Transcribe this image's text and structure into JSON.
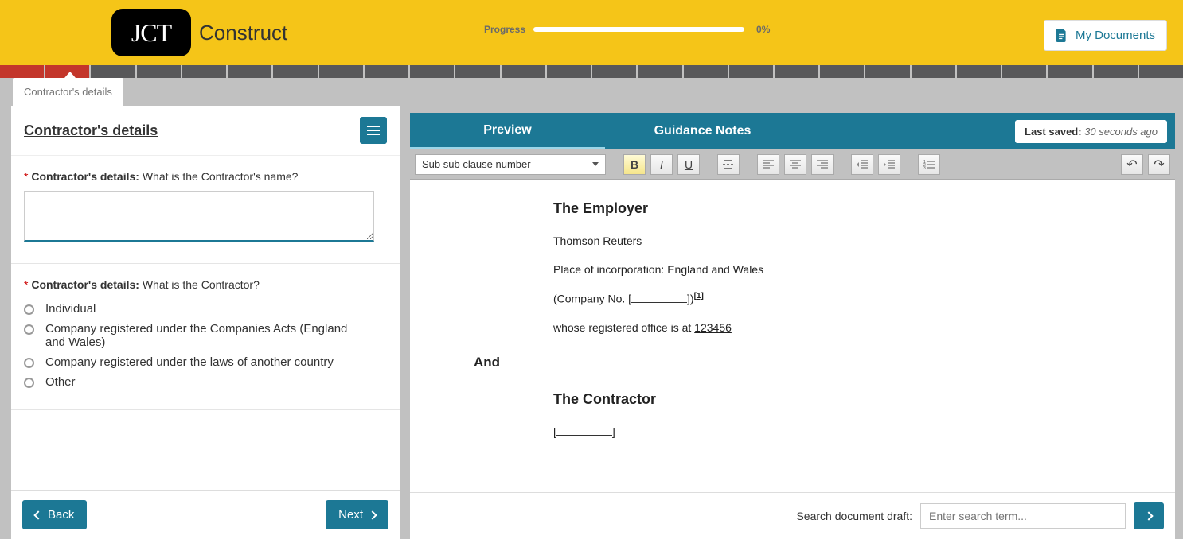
{
  "header": {
    "logo_text": "JCT",
    "brand": "Construct",
    "progress_label": "Progress",
    "progress_pct": "0%",
    "my_documents": "My Documents"
  },
  "left": {
    "tab_label": "Contractor's details",
    "title": "Contractor's details",
    "q1": {
      "label": "Contractor's details:",
      "question": "What is the Contractor's name?",
      "value": ""
    },
    "q2": {
      "label": "Contractor's details:",
      "question": "What is the Contractor?",
      "options": [
        "Individual",
        "Company registered under the Companies Acts (England and Wales)",
        "Company registered under the laws of another country",
        "Other"
      ]
    },
    "back": "Back",
    "next": "Next"
  },
  "right": {
    "tabs": {
      "preview": "Preview",
      "guidance": "Guidance Notes"
    },
    "last_saved_label": "Last saved:",
    "last_saved_time": "30 seconds ago",
    "style_select": "Sub sub clause number",
    "doc": {
      "employer_heading": "The Employer",
      "employer_name": "Thomson Reuters",
      "place_line": "Place of incorporation: England and Wales",
      "company_prefix": "(Company No. [",
      "company_suffix": "])",
      "footnote": "[1]",
      "office_prefix": "whose registered office is at ",
      "office_value": "123456",
      "and": "And",
      "contractor_heading": "The Contractor",
      "contractor_blank_open": "[",
      "contractor_blank_close": "]"
    },
    "search_label": "Search document draft:",
    "search_placeholder": "Enter search term..."
  }
}
